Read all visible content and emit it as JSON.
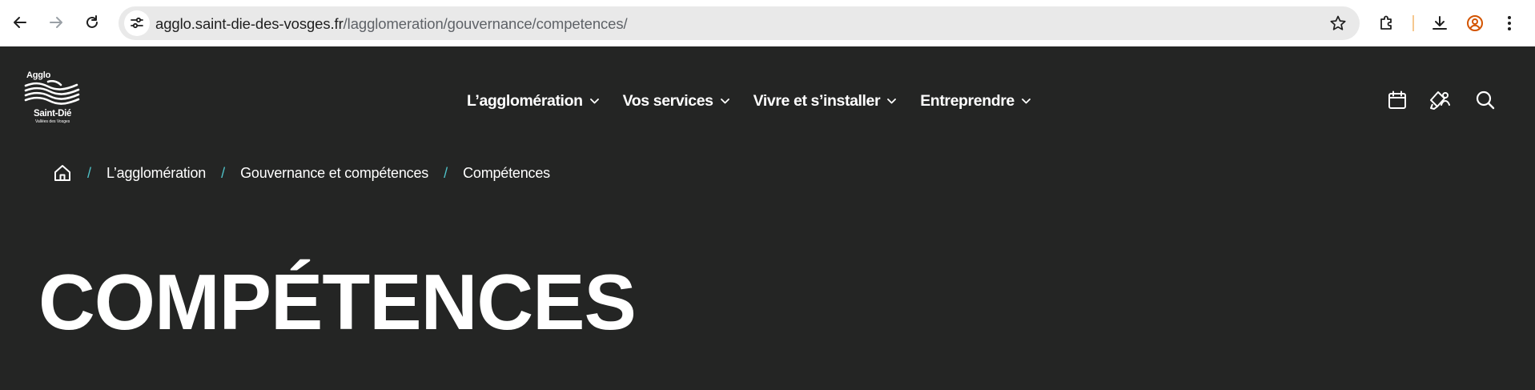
{
  "browser": {
    "url_host": "agglo.saint-die-des-vosges.fr",
    "url_path": "/lagglomeration/gouvernance/competences/",
    "icons": [
      "back-icon",
      "forward-icon",
      "reload-icon",
      "site-info-icon",
      "bookmark-star-icon",
      "extensions-icon",
      "download-icon",
      "profile-icon",
      "more-menu-icon"
    ],
    "profile_color": "#d35400"
  },
  "logo": {
    "top": "Agglo",
    "bottom": "Saint-Dié",
    "sub": "Vallées des Vosges"
  },
  "nav": {
    "items": [
      {
        "label": "L’agglomération"
      },
      {
        "label": "Vos services"
      },
      {
        "label": "Vivre et s’installer"
      },
      {
        "label": "Entreprendre"
      }
    ],
    "icons": [
      "calendar-icon",
      "pen-user-icon",
      "search-icon"
    ]
  },
  "breadcrumb": {
    "items": [
      "L’agglomération",
      "Gouvernance et compétences",
      "Compétences"
    ],
    "separator": "/",
    "separator_color": "#4fc2c8"
  },
  "page": {
    "title": "COMPÉTENCES",
    "background": "#242524"
  }
}
